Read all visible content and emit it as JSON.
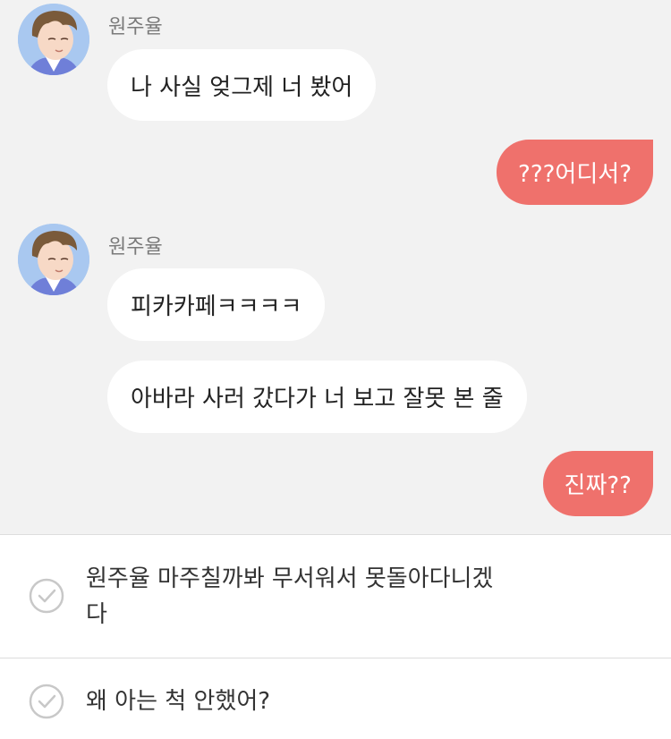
{
  "messages": [
    {
      "sender": "원주율",
      "text": "나 사실 엊그제 너 봤어"
    },
    {
      "text": "???어디서?"
    },
    {
      "sender": "원주율",
      "text": "피카카페ㅋㅋㅋㅋ"
    },
    {
      "text": "아바라 사러 갔다가 너 보고 잘못 본 줄"
    },
    {
      "text": "진짜??"
    }
  ],
  "choices": [
    {
      "text": "원주율 마주칠까봐 무서워서 못돌아다니겠다",
      "icon": "check-circle-icon"
    },
    {
      "text": "왜 아는 척 안했어?",
      "icon": "check-circle-icon"
    }
  ],
  "colors": {
    "background": "#f2f2f2",
    "incoming_bubble": "#ffffff",
    "outgoing_bubble": "#ef716c",
    "choice_background": "#ffffff"
  }
}
